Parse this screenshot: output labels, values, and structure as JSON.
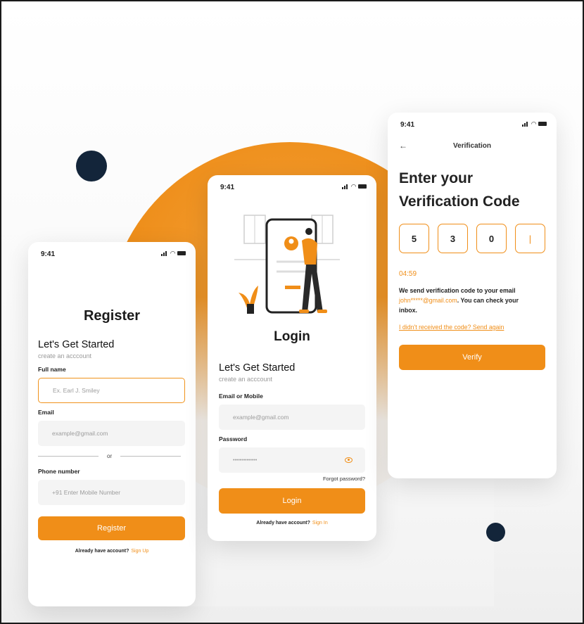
{
  "colors": {
    "accent": "#f08e18",
    "dark_dot": "#13253a",
    "background": "#f6f6f6"
  },
  "status_time": "9:41",
  "register": {
    "title": "Register",
    "heading": "Let's Get Started",
    "subheading": "create an  acccount",
    "full_name_label": "Full name",
    "full_name_placeholder": "Ex. Earl J. Smiley",
    "email_label": "Email",
    "email_placeholder": "example@gmail.com",
    "or_text": "or",
    "phone_label": "Phone number",
    "phone_placeholder": "+91 Enter Mobile Number",
    "button": "Register",
    "footer_text": "Already have account?",
    "footer_link": "Sign Up"
  },
  "login": {
    "title": "Login",
    "heading": "Let's Get Started",
    "subheading": "create an  acccount",
    "email_label": "Email or Mobile",
    "email_placeholder": "example@gmail.com",
    "password_label": "Password",
    "password_value": "••••••••••••••",
    "forgot": "Forgot password?",
    "button": "Login",
    "footer_text": "Already have account?",
    "footer_link": "Sign In",
    "illustration_icon": "person-with-phone-illustration"
  },
  "verify": {
    "nav_title": "Verification",
    "back_icon": "arrow-left-icon",
    "title_line1": "Enter your",
    "title_line2": "Verification Code",
    "otp_digits": [
      "5",
      "3",
      "0",
      "|"
    ],
    "timer": "04:59",
    "message_pre": "We send verification code to your email ",
    "message_email": "john*****@gmail.com",
    "message_post": ". You can check your inbox.",
    "resend": "I didn't received the code? Send again",
    "button": "Verify"
  }
}
